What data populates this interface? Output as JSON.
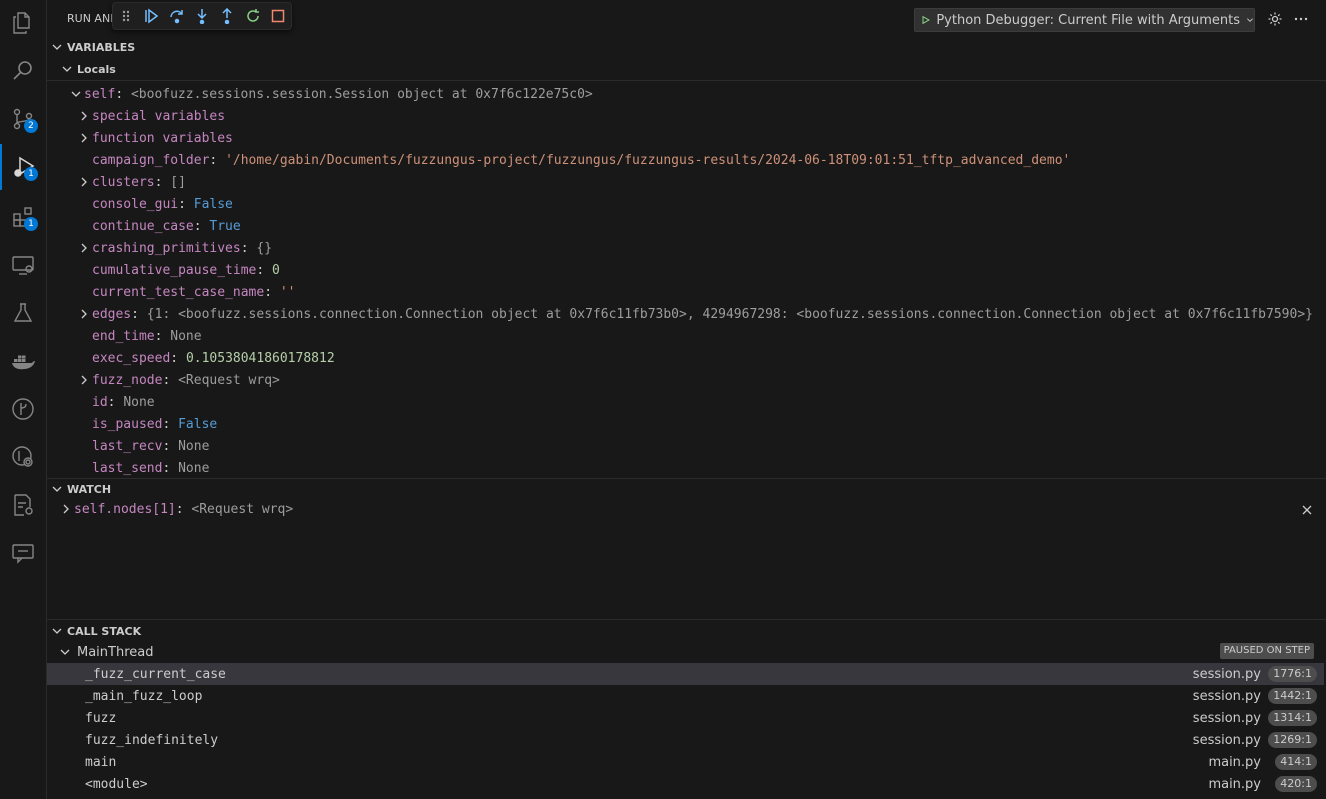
{
  "activity_bar": {
    "items": [
      {
        "icon": "files-icon"
      },
      {
        "icon": "search-icon"
      },
      {
        "icon": "source-control-icon",
        "badge": "2"
      },
      {
        "icon": "run-debug-icon",
        "badge": "1",
        "active": true
      },
      {
        "icon": "extensions-icon",
        "badge": "1"
      },
      {
        "icon": "remote-explorer-icon"
      },
      {
        "icon": "testing-icon"
      },
      {
        "icon": "docker-icon"
      },
      {
        "icon": "git-graph-icon"
      },
      {
        "icon": "git-lens-icon"
      },
      {
        "icon": "settings-sync-icon"
      },
      {
        "icon": "comments-icon"
      }
    ]
  },
  "top": {
    "title": "RUN AND",
    "launch_config": "Python Debugger: Current File with Arguments"
  },
  "variables": {
    "header": "VARIABLES",
    "locals_header": "Locals",
    "self_name": "self",
    "self_value": "<boofuzz.sessions.session.Session object at 0x7f6c122e75c0>",
    "items": [
      {
        "name": "special variables",
        "value": "",
        "kind": "plain",
        "expandable": true
      },
      {
        "name": "function variables",
        "value": "",
        "kind": "plain",
        "expandable": true
      },
      {
        "name": "campaign_folder",
        "value": "'/home/gabin/Documents/fuzzungus-project/fuzzungus/fuzzungus-results/2024-06-18T09:01:51_tftp_advanced_demo'",
        "kind": "str",
        "expandable": false
      },
      {
        "name": "clusters",
        "value": "[]",
        "kind": "obj",
        "expandable": true
      },
      {
        "name": "console_gui",
        "value": "False",
        "kind": "bool",
        "expandable": false
      },
      {
        "name": "continue_case",
        "value": "True",
        "kind": "bool",
        "expandable": false
      },
      {
        "name": "crashing_primitives",
        "value": "{}",
        "kind": "obj",
        "expandable": true
      },
      {
        "name": "cumulative_pause_time",
        "value": "0",
        "kind": "num",
        "expandable": false
      },
      {
        "name": "current_test_case_name",
        "value": "''",
        "kind": "str",
        "expandable": false
      },
      {
        "name": "edges",
        "value": "{1: <boofuzz.sessions.connection.Connection object at 0x7f6c11fb73b0>, 4294967298: <boofuzz.sessions.connection.Connection object at 0x7f6c11fb7590>}",
        "kind": "obj",
        "expandable": true
      },
      {
        "name": "end_time",
        "value": "None",
        "kind": "obj",
        "expandable": false
      },
      {
        "name": "exec_speed",
        "value": "0.10538041860178812",
        "kind": "num",
        "expandable": false
      },
      {
        "name": "fuzz_node",
        "value": "<Request wrq>",
        "kind": "obj",
        "expandable": true
      },
      {
        "name": "id",
        "value": "None",
        "kind": "obj",
        "expandable": false
      },
      {
        "name": "is_paused",
        "value": "False",
        "kind": "bool",
        "expandable": false
      },
      {
        "name": "last_recv",
        "value": "None",
        "kind": "obj",
        "expandable": false
      },
      {
        "name": "last_send",
        "value": "None",
        "kind": "obj",
        "expandable": false
      }
    ]
  },
  "watch": {
    "header": "WATCH",
    "items": [
      {
        "name": "self.nodes[1]",
        "value": "<Request wrq>"
      }
    ]
  },
  "call_stack": {
    "header": "CALL STACK",
    "thread": "MainThread",
    "status": "PAUSED ON STEP",
    "frames": [
      {
        "name": "_fuzz_current_case",
        "file": "session.py",
        "line": "1776:1",
        "selected": true
      },
      {
        "name": "_main_fuzz_loop",
        "file": "session.py",
        "line": "1442:1"
      },
      {
        "name": "fuzz",
        "file": "session.py",
        "line": "1314:1"
      },
      {
        "name": "fuzz_indefinitely",
        "file": "session.py",
        "line": "1269:1"
      },
      {
        "name": "main",
        "file": "main.py",
        "line": "414:1"
      },
      {
        "name": "<module>",
        "file": "main.py",
        "line": "420:1"
      }
    ]
  },
  "colors": {
    "accent": "#0078d4",
    "name": "#c586c0",
    "string": "#ce9178",
    "boolean": "#569cd6",
    "number": "#b5cea8"
  }
}
